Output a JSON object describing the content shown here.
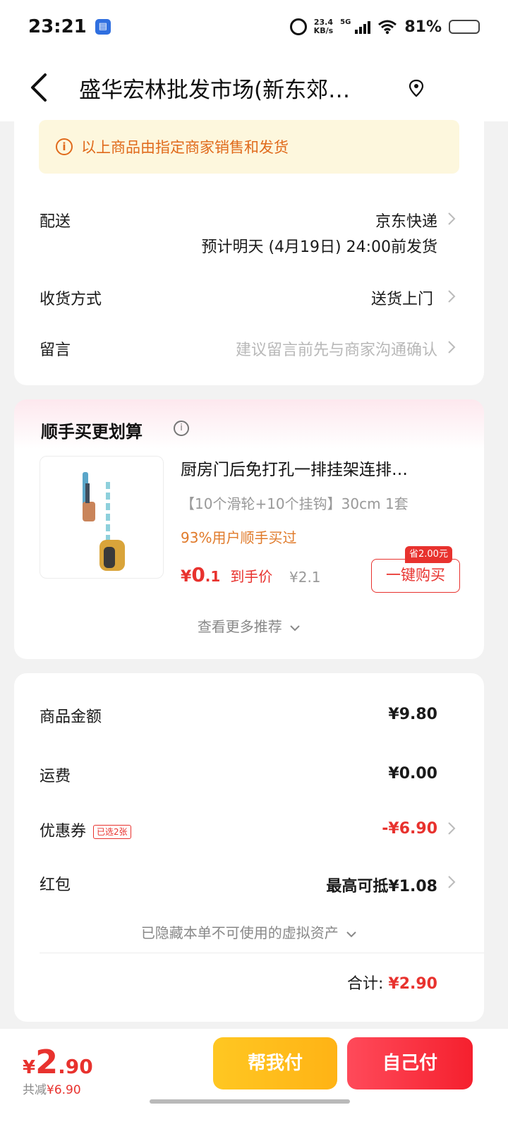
{
  "status_bar": {
    "time": "23:21",
    "net_speed_value": "23.4",
    "net_speed_unit": "KB/s",
    "network": "5G",
    "battery_pct": "81%",
    "battery_level": 0.81
  },
  "nav": {
    "title": "盛华宏林批发市场(新东郊…"
  },
  "delivery": {
    "notice": "以上商品由指定商家销售和发货",
    "shipping_label": "配送",
    "shipping_value": "京东快递",
    "shipping_eta": "预计明天 (4月19日) 24:00前发货",
    "receive_label": "收货方式",
    "receive_value": "送货上门",
    "message_label": "留言",
    "message_placeholder": "建议留言前先与商家沟通确认"
  },
  "recommend": {
    "title": "顺手买更划算",
    "product_title": "厨房门后免打孔一排挂架连排…",
    "product_spec": "【10个滑轮+10个挂钩】30cm 1套",
    "social_proof": "93%用户顺手买过",
    "price_symbol": "¥",
    "price_int": "0",
    "price_dec": ".1",
    "price_label": "到手价",
    "original_price": "¥2.1",
    "save_tag": "省2.00元",
    "buy_button": "一键购买",
    "more": "查看更多推荐"
  },
  "summary": {
    "goods_label": "商品金额",
    "goods_value": "¥9.80",
    "freight_label": "运费",
    "freight_value": "¥0.00",
    "coupon_label": "优惠券",
    "coupon_tag": "已选2张",
    "coupon_value": "-¥6.90",
    "redpacket_label": "红包",
    "redpacket_value": "最高可抵¥1.08",
    "hidden_assets": "已隐藏本单不可使用的虚拟资产",
    "total_label": "合计:",
    "total_value": "¥2.90"
  },
  "pay": {
    "symbol": "¥",
    "int": "2",
    "dec": ".90",
    "saved_label": "共减",
    "saved_value": "¥6.90",
    "help_button": "帮我付",
    "self_button": "自己付"
  },
  "colors": {
    "accent_red": "#e8322e",
    "notice_orange": "#e06a1b",
    "help_yellow": "#ffc722"
  }
}
